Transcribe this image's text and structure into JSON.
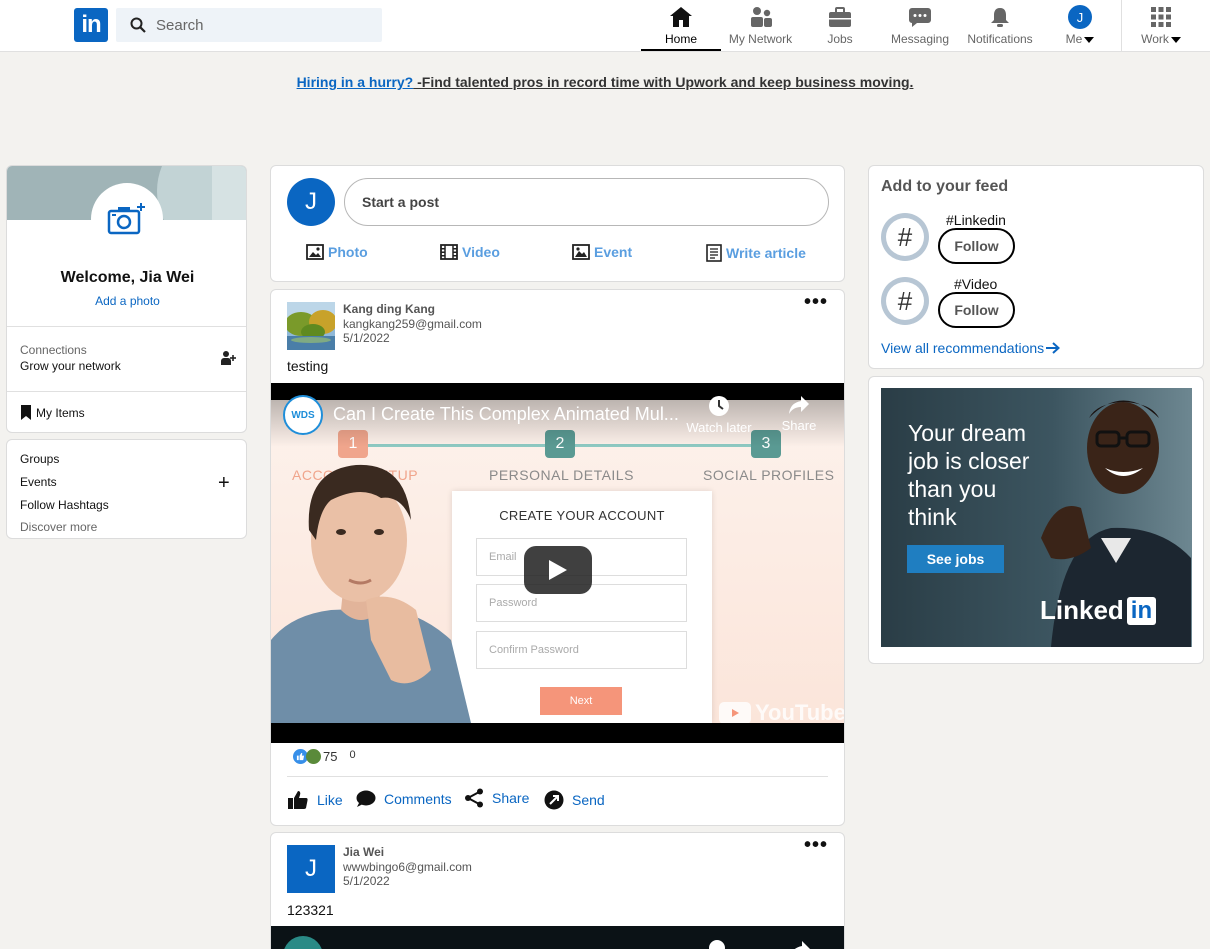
{
  "nav": {
    "logo": "in",
    "search_placeholder": "Search",
    "items": [
      {
        "label": "Home",
        "icon": "home-icon",
        "active": true
      },
      {
        "label": "My Network",
        "icon": "network-icon"
      },
      {
        "label": "Jobs",
        "icon": "briefcase-icon"
      },
      {
        "label": "Messaging",
        "icon": "message-icon"
      },
      {
        "label": "Notifications",
        "icon": "bell-icon"
      },
      {
        "label": "Me",
        "icon": "avatar"
      },
      {
        "label": "Work",
        "icon": "grid-icon"
      }
    ],
    "me_initial": "J"
  },
  "banner": {
    "link": "Hiring in a hurry?",
    "text": " -Find talented pros in record time with Upwork and keep business moving."
  },
  "profile": {
    "welcome": "Welcome, Jia Wei",
    "add_photo": "Add a photo",
    "connections_label": "Connections",
    "connections_sub": "Grow your network",
    "my_items": "My Items"
  },
  "groups": {
    "groups": "Groups",
    "events": "Events",
    "hashtags": "Follow Hashtags",
    "discover": "Discover more"
  },
  "composer": {
    "avatar_initial": "J",
    "start_post": "Start a post",
    "photo": "Photo",
    "video": "Video",
    "event": "Event",
    "article": "Write article"
  },
  "posts": [
    {
      "author": "Kang ding Kang",
      "email": "kangkang259@gmail.com",
      "date": "5/1/2022",
      "text": "testing",
      "video": {
        "channel": "WDS",
        "title": "Can I Create This Complex Animated Mul...",
        "watch_later": "Watch later",
        "share": "Share",
        "steps": [
          "1",
          "2",
          "3"
        ],
        "step_labels": [
          "ACCOUNT SETUP",
          "PERSONAL DETAILS",
          "SOCIAL PROFILES"
        ],
        "form_title": "CREATE YOUR ACCOUNT",
        "fields": [
          "Email",
          "Password",
          "Confirm Password"
        ],
        "next": "Next",
        "youtube": "YouTube"
      },
      "reaction_count": "75",
      "comment_count": "0",
      "actions": {
        "like": "Like",
        "comments": "Comments",
        "share": "Share",
        "send": "Send"
      }
    },
    {
      "author": "Jia Wei",
      "email": "wwwbingo6@gmail.com",
      "date": "5/1/2022",
      "text": "123321",
      "avatar_initial": "J"
    }
  ],
  "feed": {
    "title": "Add to your feed",
    "recommendations": [
      {
        "tag": "#Linkedin",
        "follow": "Follow"
      },
      {
        "tag": "#Video",
        "follow": "Follow"
      }
    ],
    "view_all": "View all recommendations"
  },
  "ad": {
    "text": "Your dream job is closer than you think",
    "button": "See jobs",
    "logo_text": "Linked",
    "logo_in": "in"
  },
  "colors": {
    "brand": "#0a66c2",
    "background": "#f3f2ef"
  }
}
